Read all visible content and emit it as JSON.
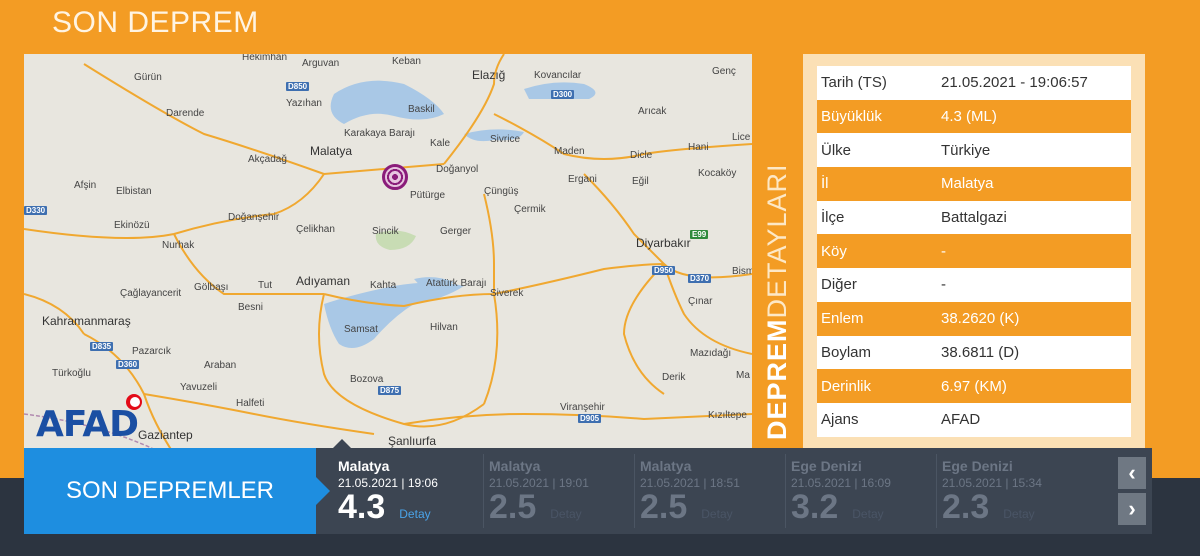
{
  "page": {
    "title": "SON DEPREM"
  },
  "map": {
    "labels": [
      {
        "t": "Hekimhan",
        "big": false
      },
      {
        "t": "Arguvan",
        "big": false
      },
      {
        "t": "Keban",
        "big": false
      },
      {
        "t": "Elazığ",
        "big": true
      },
      {
        "t": "Kovancılar",
        "big": false
      },
      {
        "t": "Genç",
        "big": false
      },
      {
        "t": "Gürün",
        "big": false
      },
      {
        "t": "Darende",
        "big": false
      },
      {
        "t": "Yazıhan",
        "big": false
      },
      {
        "t": "Baskil",
        "big": false
      },
      {
        "t": "Arıcak",
        "big": false
      },
      {
        "t": "Karakaya Barajı",
        "big": false
      },
      {
        "t": "Kale",
        "big": false
      },
      {
        "t": "Sivrice",
        "big": false
      },
      {
        "t": "Hani",
        "big": false
      },
      {
        "t": "Lice",
        "big": false
      },
      {
        "t": "Akçadağ",
        "big": false
      },
      {
        "t": "Malatya",
        "big": true
      },
      {
        "t": "Doğanyol",
        "big": false
      },
      {
        "t": "Maden",
        "big": false
      },
      {
        "t": "Dicle",
        "big": false
      },
      {
        "t": "Kocaköy",
        "big": false
      },
      {
        "t": "Afşin",
        "big": false
      },
      {
        "t": "Elbistan",
        "big": false
      },
      {
        "t": "Pütürge",
        "big": false
      },
      {
        "t": "Çüngüş",
        "big": false
      },
      {
        "t": "Ergani",
        "big": false
      },
      {
        "t": "Eğil",
        "big": false
      },
      {
        "t": "Çermik",
        "big": false
      },
      {
        "t": "Ekinözü",
        "big": false
      },
      {
        "t": "Doğanşehir",
        "big": false
      },
      {
        "t": "Çelikhan",
        "big": false
      },
      {
        "t": "Sincik",
        "big": false
      },
      {
        "t": "Gerger",
        "big": false
      },
      {
        "t": "Diyarbakır",
        "big": true
      },
      {
        "t": "Nurhak",
        "big": false
      },
      {
        "t": "Bism",
        "big": false
      },
      {
        "t": "Çağlayancerit",
        "big": false
      },
      {
        "t": "Gölbaşı",
        "big": false
      },
      {
        "t": "Tut",
        "big": false
      },
      {
        "t": "Adıyaman",
        "big": true
      },
      {
        "t": "Kahta",
        "big": false
      },
      {
        "t": "Atatürk Barajı",
        "big": false
      },
      {
        "t": "Siverek",
        "big": false
      },
      {
        "t": "Çınar",
        "big": false
      },
      {
        "t": "Besni",
        "big": false
      },
      {
        "t": "Kahramanmaraş",
        "big": true
      },
      {
        "t": "Samsat",
        "big": false
      },
      {
        "t": "Hilvan",
        "big": false
      },
      {
        "t": "Pazarcık",
        "big": false
      },
      {
        "t": "Mazıdağı",
        "big": false
      },
      {
        "t": "Türkoğlu",
        "big": false
      },
      {
        "t": "Araban",
        "big": false
      },
      {
        "t": "Bozova",
        "big": false
      },
      {
        "t": "Derik",
        "big": false
      },
      {
        "t": "Ma",
        "big": false
      },
      {
        "t": "Yavuzeli",
        "big": false
      },
      {
        "t": "Halfeti",
        "big": false
      },
      {
        "t": "Viranşehir",
        "big": false
      },
      {
        "t": "Kızıltepe",
        "big": false
      },
      {
        "t": "Şanlıurfa",
        "big": true
      },
      {
        "t": "Gaziantep",
        "big": true
      }
    ],
    "roads": [
      "D850",
      "D300",
      "D330",
      "E99",
      "D950",
      "D370",
      "D835",
      "D360",
      "D875",
      "D905"
    ],
    "logo": "AFAD",
    "marker_icon": "earthquake-epicenter-icon"
  },
  "details": {
    "vertical_label_bold": "DEPREM",
    "vertical_label_rest": "DETAYLARI",
    "rows": [
      {
        "key": "Tarih (TS)",
        "value": "21.05.2021 - 19:06:57"
      },
      {
        "key": "Büyüklük",
        "value": "4.3 (ML)"
      },
      {
        "key": "Ülke",
        "value": "Türkiye"
      },
      {
        "key": "İl",
        "value": "Malatya"
      },
      {
        "key": "İlçe",
        "value": "Battalgazi"
      },
      {
        "key": "Köy",
        "value": "-"
      },
      {
        "key": "Diğer",
        "value": "-"
      },
      {
        "key": "Enlem",
        "value": "38.2620 (K)"
      },
      {
        "key": "Boylam",
        "value": "38.6811 (D)"
      },
      {
        "key": "Derinlik",
        "value": "6.97 (KM)"
      },
      {
        "key": "Ajans",
        "value": "AFAD"
      }
    ]
  },
  "recent": {
    "title": "SON DEPREMLER",
    "items": [
      {
        "loc": "Malatya",
        "dt": "21.05.2021 | 19:06",
        "mag": "4.3",
        "det": "Detay"
      },
      {
        "loc": "Malatya",
        "dt": "21.05.2021 | 19:01",
        "mag": "2.5",
        "det": "Detay"
      },
      {
        "loc": "Malatya",
        "dt": "21.05.2021 | 18:51",
        "mag": "2.5",
        "det": "Detay"
      },
      {
        "loc": "Ege Denizi",
        "dt": "21.05.2021 | 16:09",
        "mag": "3.2",
        "det": "Detay"
      },
      {
        "loc": "Ege Denizi",
        "dt": "21.05.2021 | 15:34",
        "mag": "2.3",
        "det": "Detay"
      }
    ],
    "prev_icon": "chevron-left-icon",
    "next_icon": "chevron-right-icon",
    "prev_glyph": "‹",
    "next_glyph": "›"
  }
}
